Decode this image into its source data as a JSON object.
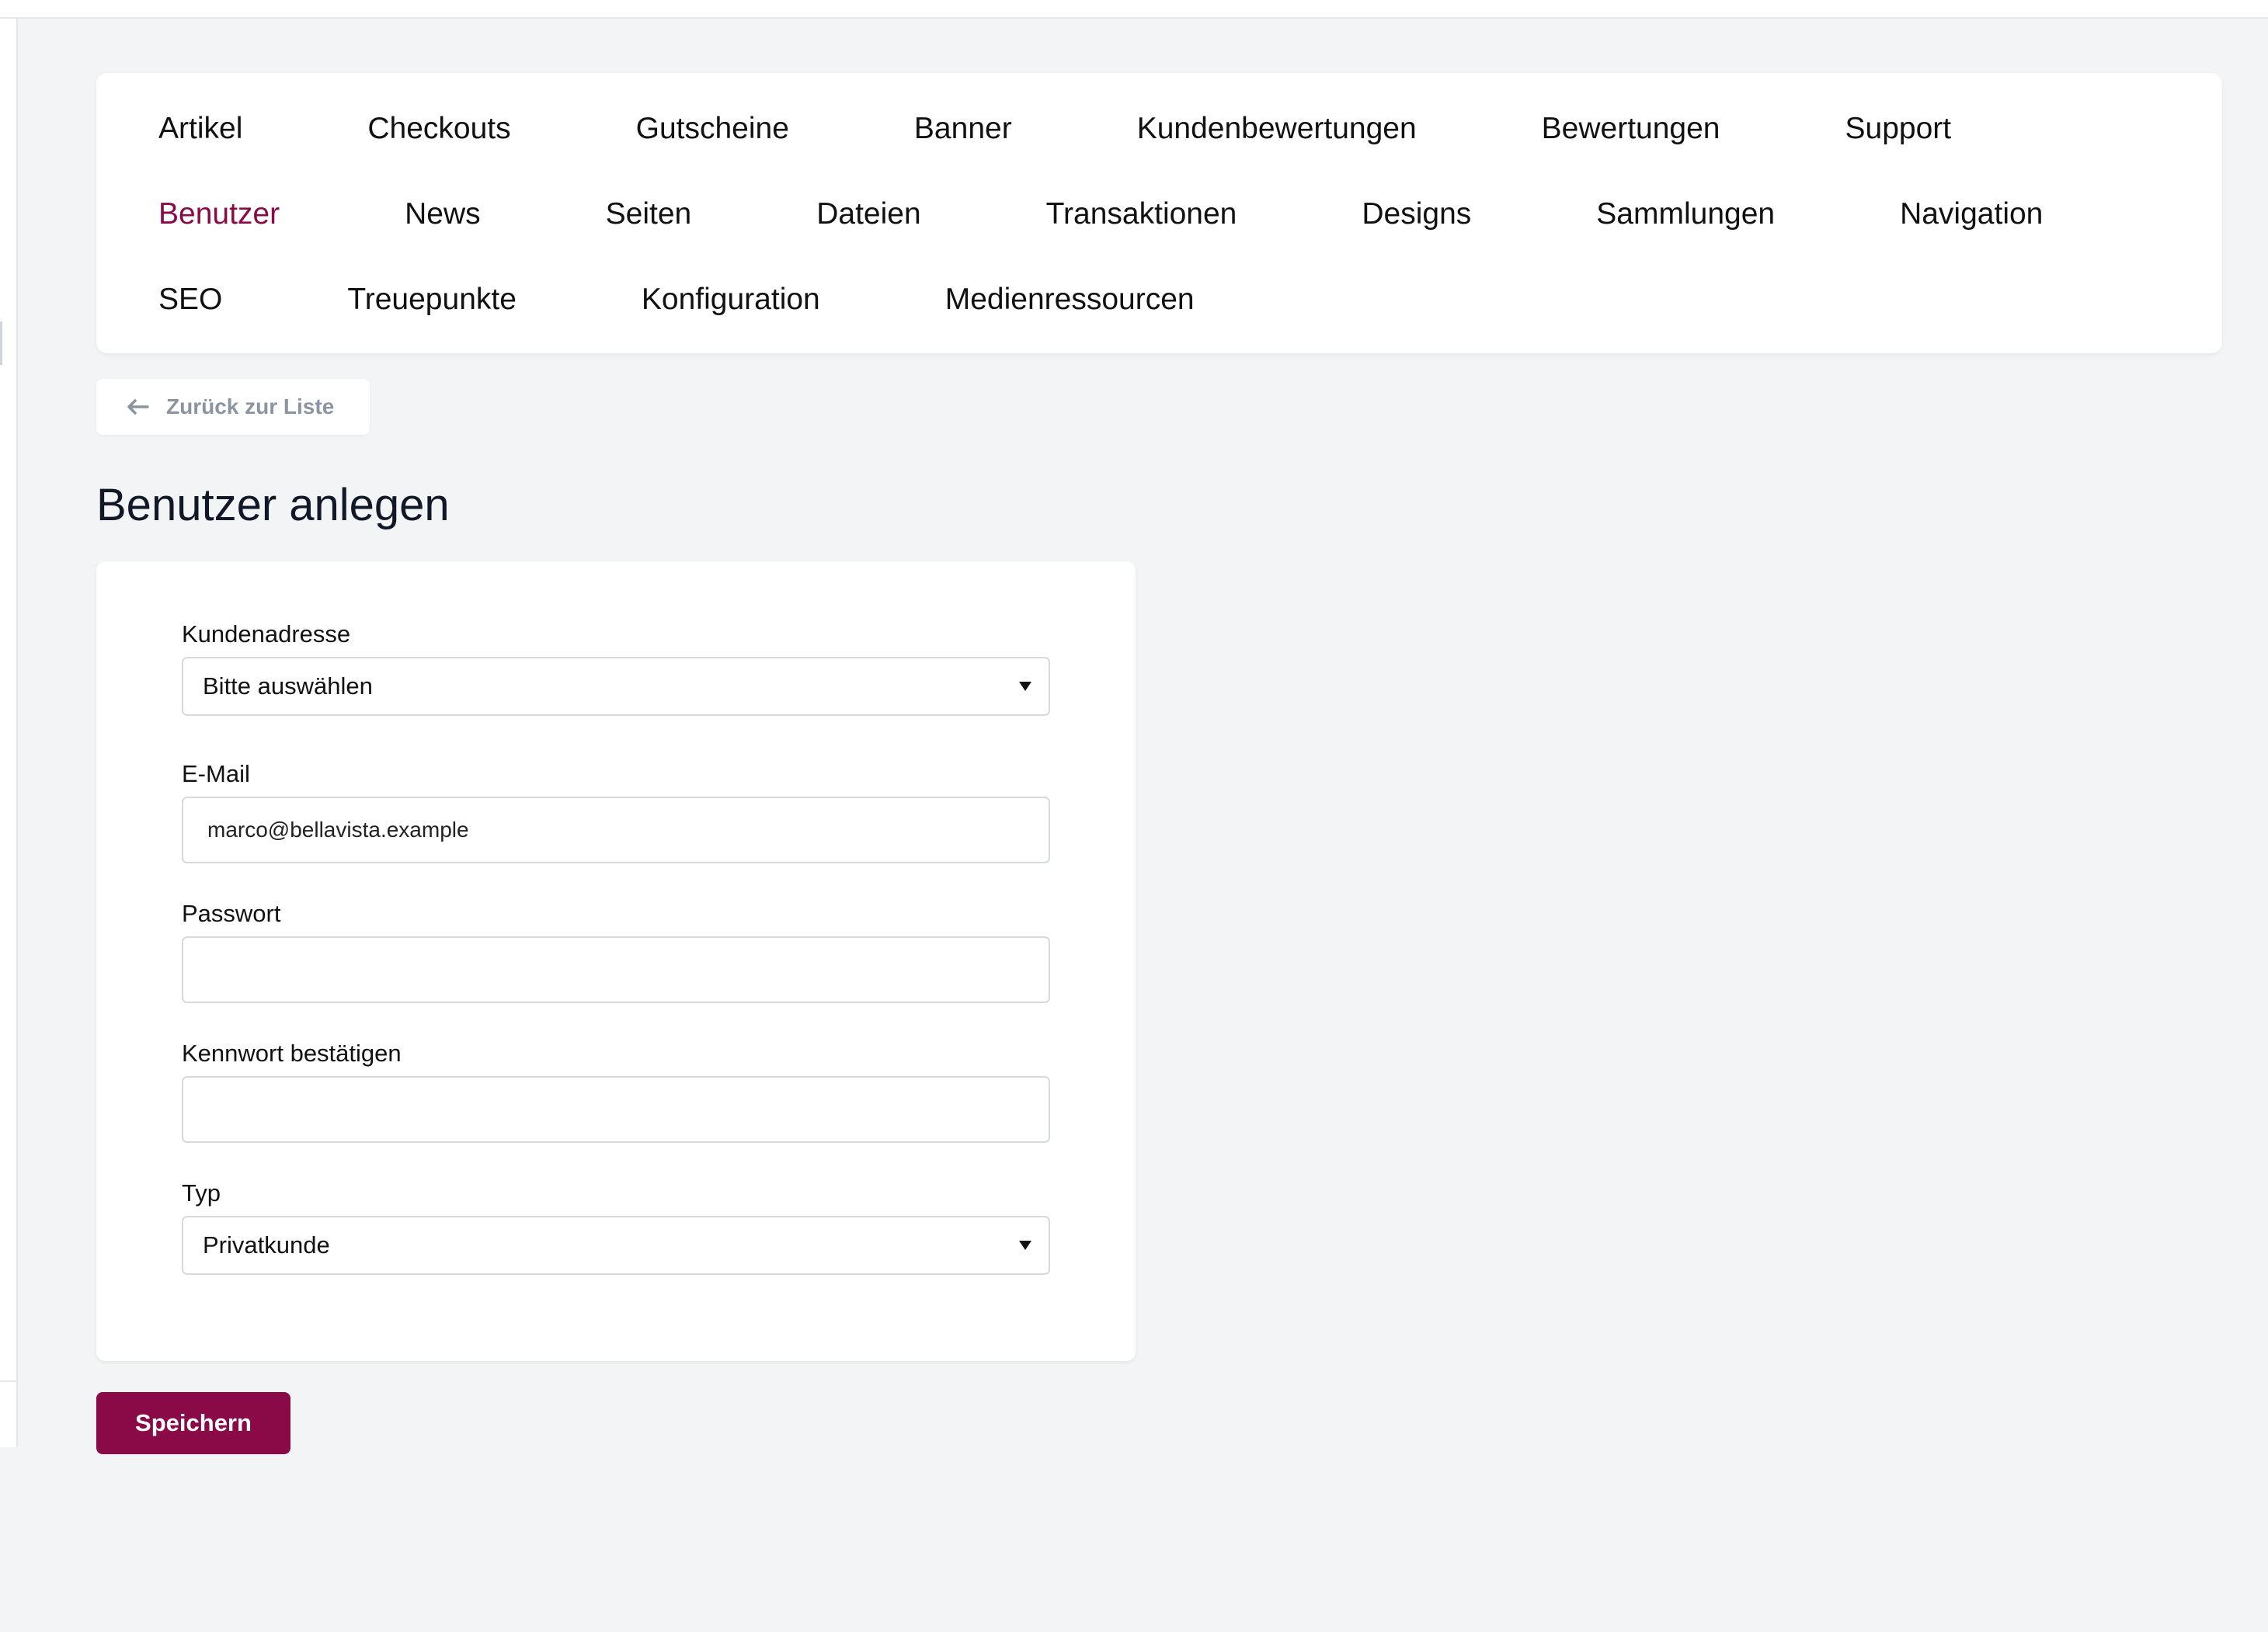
{
  "nav": {
    "row1": [
      "Artikel",
      "Checkouts",
      "Gutscheine",
      "Banner",
      "Kundenbewertungen",
      "Bewertungen",
      "Support"
    ],
    "row2": [
      "Benutzer",
      "News",
      "Seiten",
      "Dateien",
      "Transaktionen",
      "Designs",
      "Sammlungen",
      "Navigation"
    ],
    "row3": [
      "SEO",
      "Treuepunkte",
      "Konfiguration",
      "Medienressourcen"
    ],
    "active": "Benutzer"
  },
  "back": {
    "label": "Zurück zur Liste",
    "icon": "arrow-left-icon"
  },
  "page": {
    "title": "Benutzer anlegen"
  },
  "form": {
    "address": {
      "label": "Kundenadresse",
      "value": "Bitte auswählen"
    },
    "email": {
      "label": "E-Mail",
      "value": "marco@bellavista.example"
    },
    "password": {
      "label": "Passwort",
      "value": ""
    },
    "confirm": {
      "label": "Kennwort bestätigen",
      "value": ""
    },
    "type": {
      "label": "Typ",
      "value": "Privatkunde"
    }
  },
  "actions": {
    "save_label": "Speichern"
  },
  "colors": {
    "accent": "#8a0a47",
    "background": "#f3f4f6",
    "muted": "#8b95a1"
  }
}
